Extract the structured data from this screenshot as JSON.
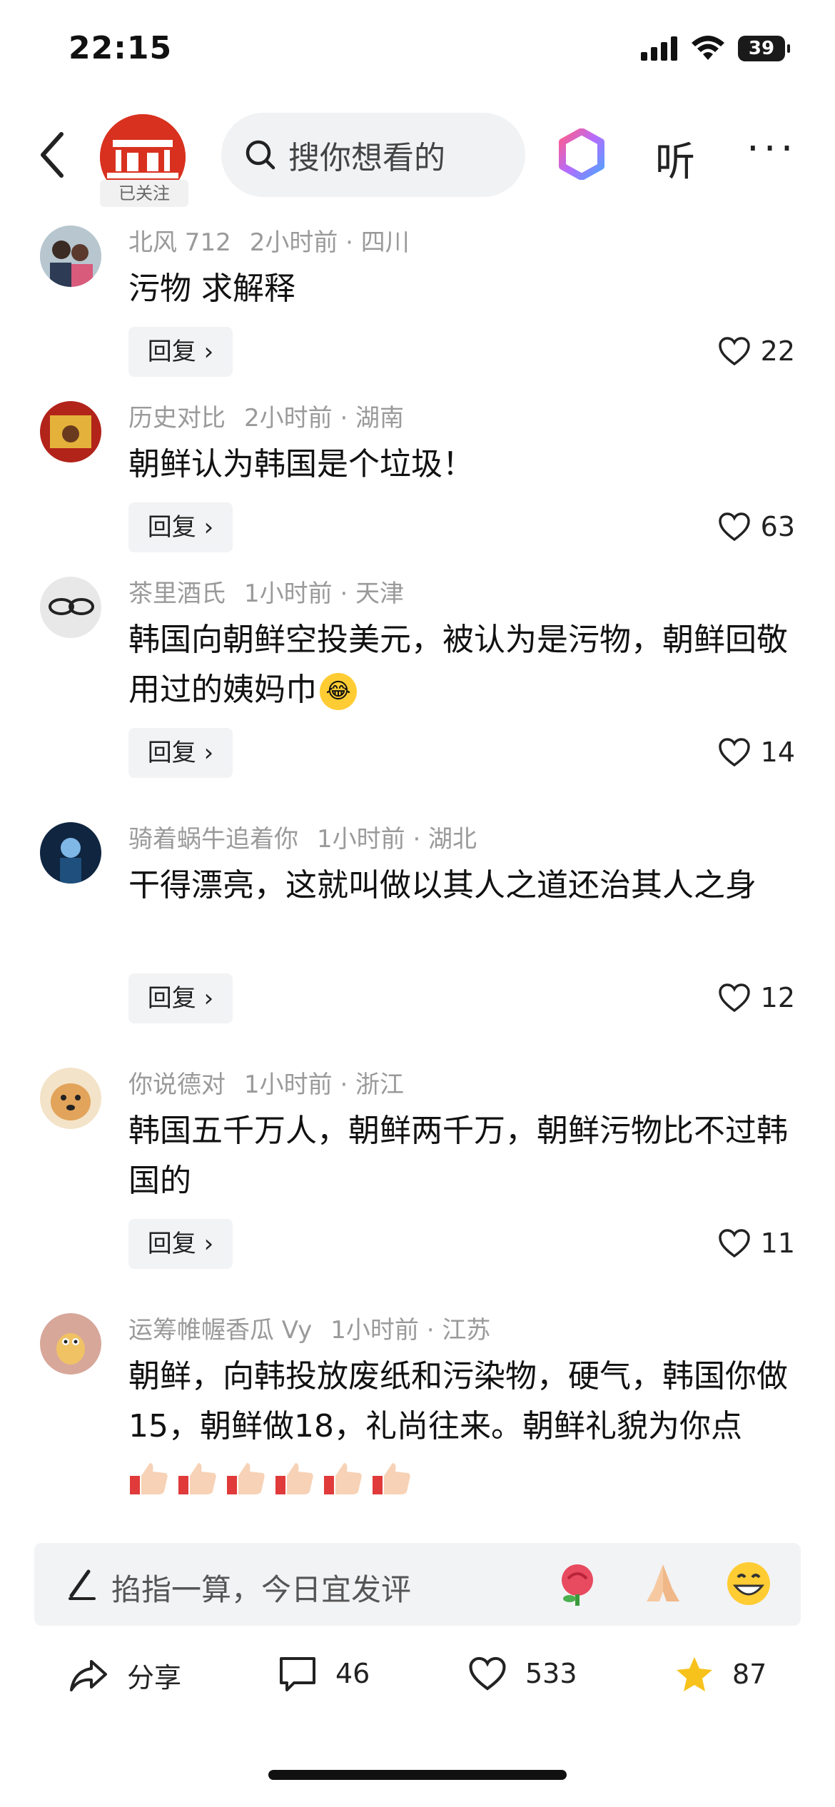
{
  "status_bar": {
    "time": "22:15",
    "battery": "39"
  },
  "header": {
    "followed_label": "已关注",
    "search_placeholder": "搜你想看的",
    "listen_label": "听",
    "more_label": "···"
  },
  "comments": [
    {
      "user": "北风 712",
      "time": "2小时前 · 四川",
      "text": "污物 求解释",
      "reply": "回复 ›",
      "likes": "22"
    },
    {
      "user": "历史对比",
      "time": "2小时前 · 湖南",
      "text": "朝鲜认为韩国是个垃圾！",
      "reply": "回复 ›",
      "likes": "63"
    },
    {
      "user": "茶里酒氏",
      "time": "1小时前 · 天津",
      "text": "韩国向朝鲜空投美元，被认为是污物，朝鲜回敬用过的姨妈巾",
      "reply": "回复 ›",
      "likes": "14"
    },
    {
      "user": "骑着蜗牛追着你",
      "time": "1小时前 · 湖北",
      "text": "干得漂亮，这就叫做以其人之道还治其人之身",
      "reply": "回复 ›",
      "likes": "12"
    },
    {
      "user": "你说德对",
      "time": "1小时前 · 浙江",
      "text": "韩国五千万人，朝鲜两千万，朝鲜污物比不过韩国的",
      "reply": "回复 ›",
      "likes": "11"
    },
    {
      "user": "运筹帷幄香瓜 Vy",
      "time": "1小时前 · 江苏",
      "text": "朝鲜，向韩投放废纸和污染物，硬气，韩国你做15，朝鲜做18，礼尚往来。朝鲜礼貌为你点"
    }
  ],
  "input_bar": {
    "placeholder": "掐指一算，今日宜发评"
  },
  "bottom_bar": {
    "share_label": "分享",
    "comments_count": "46",
    "likes_count": "533",
    "favorites_count": "87"
  },
  "colors": {
    "brand_red": "#d9311f",
    "star_yellow": "#f7c21b",
    "meta_gray": "#9a9a9a"
  }
}
